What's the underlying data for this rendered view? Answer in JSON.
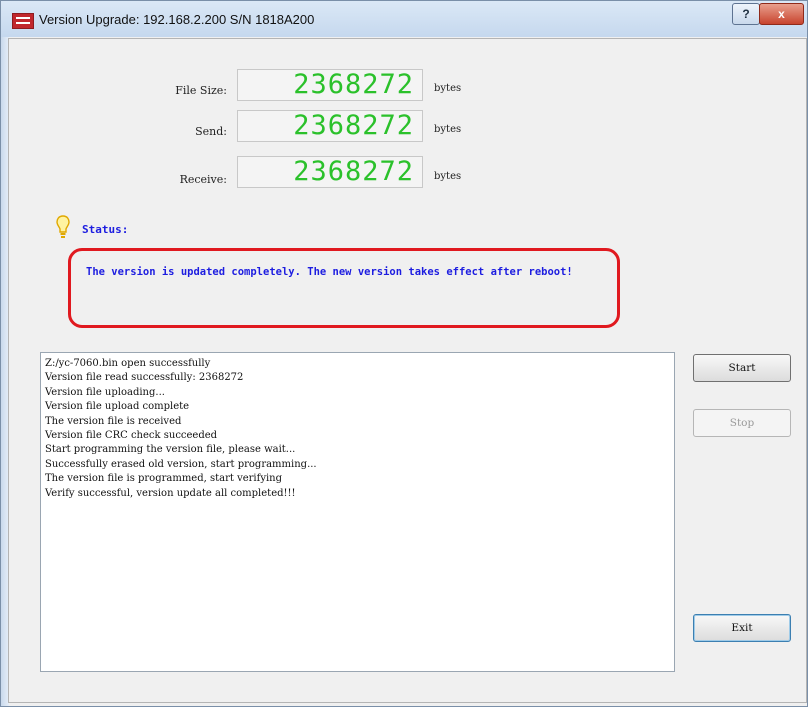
{
  "window": {
    "title": "Version Upgrade: 192.168.2.200  S/N 1818A200",
    "help_label": "?",
    "close_label": "x"
  },
  "metrics": [
    {
      "label": "File Size:",
      "value": "2368272",
      "unit": "bytes"
    },
    {
      "label": "Send:",
      "value": "2368272",
      "unit": "bytes"
    },
    {
      "label": "Receive:",
      "value": "2368272",
      "unit": "bytes"
    }
  ],
  "status": {
    "label": "Status:",
    "message": "The version is updated completely. The new version takes effect after reboot!"
  },
  "log": [
    "Z:/yc-7060.bin open successfully",
    "Version file read successfully: 2368272",
    "Version file uploading...",
    "Version file upload complete",
    "The version file is received",
    "Version file CRC check succeeded",
    "Start programming the version file, please wait...",
    "Successfully erased old version, start programming...",
    "The version file is programmed, start verifying",
    "Verify successful, version update all completed!!!"
  ],
  "buttons": {
    "start": "Start",
    "stop": "Stop",
    "exit": "Exit"
  },
  "colors": {
    "lcd_digits": "#2bc12b",
    "status_text": "#1d1de0",
    "status_border": "#e0191f"
  }
}
